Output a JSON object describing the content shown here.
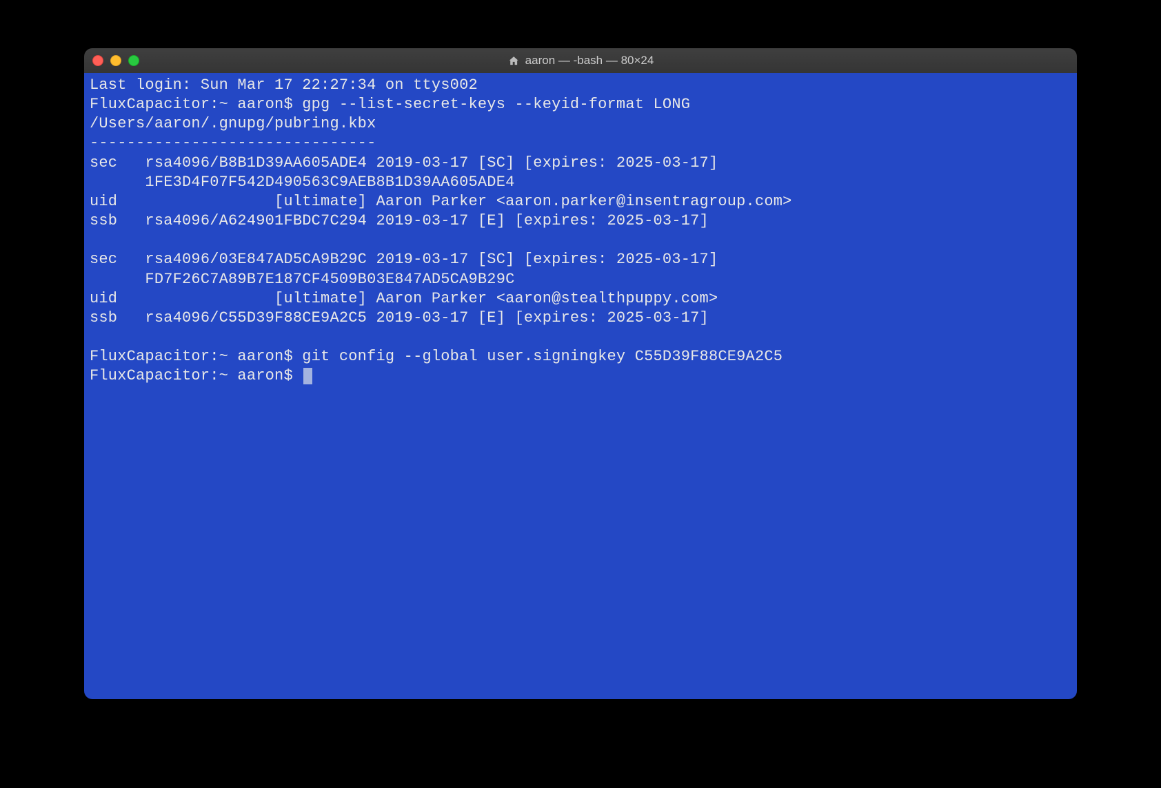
{
  "window": {
    "title": "aaron — -bash — 80×24"
  },
  "terminal": {
    "lines": [
      "Last login: Sun Mar 17 22:27:34 on ttys002",
      "FluxCapacitor:~ aaron$ gpg --list-secret-keys --keyid-format LONG",
      "/Users/aaron/.gnupg/pubring.kbx",
      "-------------------------------",
      "sec   rsa4096/B8B1D39AA605ADE4 2019-03-17 [SC] [expires: 2025-03-17]",
      "      1FE3D4F07F542D490563C9AEB8B1D39AA605ADE4",
      "uid                 [ultimate] Aaron Parker <aaron.parker@insentragroup.com>",
      "ssb   rsa4096/A624901FBDC7C294 2019-03-17 [E] [expires: 2025-03-17]",
      "",
      "sec   rsa4096/03E847AD5CA9B29C 2019-03-17 [SC] [expires: 2025-03-17]",
      "      FD7F26C7A89B7E187CF4509B03E847AD5CA9B29C",
      "uid                 [ultimate] Aaron Parker <aaron@stealthpuppy.com>",
      "ssb   rsa4096/C55D39F88CE9A2C5 2019-03-17 [E] [expires: 2025-03-17]",
      "",
      "FluxCapacitor:~ aaron$ git config --global user.signingkey C55D39F88CE9A2C5"
    ],
    "prompt": "FluxCapacitor:~ aaron$ "
  }
}
